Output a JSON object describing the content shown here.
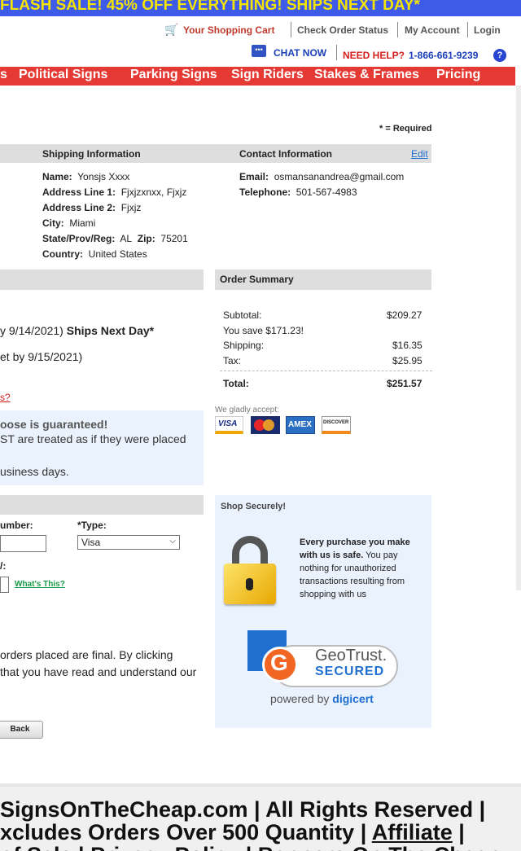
{
  "banner": {
    "text": "FLASH SALE! 45% OFF EVERYTHING! SHIPS NEXT DAY*"
  },
  "toplinks": {
    "cart": "Your Shopping Cart",
    "check_order": "Check Order Status",
    "account": "My Account",
    "login": "Login",
    "chat": "CHAT NOW",
    "help_label": "NEED HELP?",
    "phone": "1-866-661-9239"
  },
  "nav": {
    "items": [
      "s",
      "Political Signs",
      "Parking Signs",
      "Sign Riders",
      "Stakes & Frames",
      "Pricing"
    ]
  },
  "required_note": "* = Required",
  "shipping": {
    "heading": "Shipping Information",
    "name_label": "Name:",
    "name": "Yonsjs Xxxx",
    "addr1_label": "Address Line 1:",
    "addr1": "Fjxjzxnxx, Fjxjz",
    "addr2_label": "Address Line 2:",
    "addr2": "Fjxjz",
    "city_label": "City:",
    "city": "Miami",
    "state_label": "State/Prov/Reg:",
    "state": "AL",
    "zip_label": "Zip:",
    "zip": "75201",
    "country_label": "Country:",
    "country": "United States"
  },
  "contact": {
    "heading": "Contact Information",
    "edit": "Edit",
    "email_label": "Email:",
    "email": "osmansanandrea@gmail.com",
    "tel_label": "Telephone:",
    "tel": "501-567-4983"
  },
  "delivery": {
    "line1_pre": "y 9/14/2021) ",
    "line1_bold": "Ships Next Day*",
    "line2": "et by 9/15/2021)",
    "link": "s?",
    "guarantee_title": "oose is guaranteed!",
    "guarantee_line": "ST are treated as if they were placed",
    "guarantee_line2": "usiness days."
  },
  "summary": {
    "heading": "Order Summary",
    "subtotal_label": "Subtotal:",
    "subtotal": "$209.27",
    "save": "You save $171.23!",
    "shipping_label": "Shipping:",
    "shipping": "$16.35",
    "tax_label": "Tax:",
    "tax": "$25.95",
    "total_label": "Total:",
    "total": "$251.57",
    "accept": "We gladly accept:",
    "cards": [
      "VISA",
      "MasterCard",
      "AMEX",
      "DISCOVER"
    ]
  },
  "payment": {
    "number_label": "umber:",
    "type_label": "*Type:",
    "type_value": "Visa",
    "cvv_label": "/:",
    "whats_this": "What's This?",
    "final1": "orders placed are final. By clicking",
    "final2": " that you have read and understand our",
    "back": "Back"
  },
  "secure": {
    "heading": "Shop Securely!",
    "bold": "Every purchase you make with us is safe.",
    "text": " You pay nothing for unauthorized transactions resulting from shopping with us",
    "geotrust1": "GeoTrust.",
    "geotrust2": "SECURED",
    "powered": "powered by",
    "digicert": "digicert"
  },
  "footer": {
    "line1": "SignsOnTheCheap.com | All Rights Reserved |",
    "line2_pre": "xcludes Orders Over 500 Quantity | ",
    "line2_link": "Affiliate",
    "line2_post": " |",
    "line3": "of Sale | Privacy Policy | Banners On The Cheap"
  },
  "colors": {
    "accent": "#e53a33",
    "banner": "#3d5ae8",
    "banner_text": "#f5e400",
    "link": "#1a3fb8"
  }
}
